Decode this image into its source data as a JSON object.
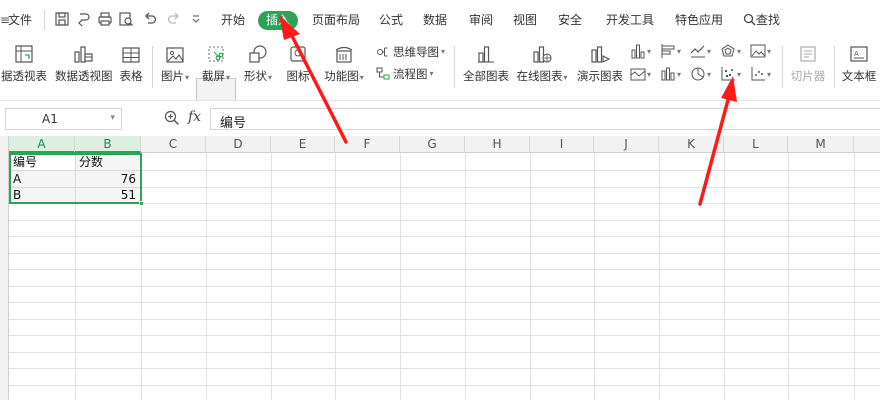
{
  "menubar": {
    "file_label": "文件",
    "tabs": [
      {
        "label": "开始",
        "active": false
      },
      {
        "label": "插入",
        "active": true
      },
      {
        "label": "页面布局",
        "active": false
      },
      {
        "label": "公式",
        "active": false
      },
      {
        "label": "数据",
        "active": false
      },
      {
        "label": "审阅",
        "active": false
      },
      {
        "label": "视图",
        "active": false
      },
      {
        "label": "安全",
        "active": false
      },
      {
        "label": "开发工具",
        "active": false
      },
      {
        "label": "特色应用",
        "active": false
      }
    ],
    "search_label": "查找",
    "accent_color": "#2ea357"
  },
  "ribbon": {
    "pivot_table": "据透视表",
    "pivot_chart": "数据透视图",
    "table": "表格",
    "picture": "图片",
    "screenshot": "截屏",
    "shapes": "形状",
    "icons": "图标",
    "function_chart": "功能图",
    "mind_map": "思维导图",
    "flowchart": "流程图",
    "all_charts": "全部图表",
    "online_charts": "在线图表",
    "demo_chart": "演示图表",
    "slicer": "切片器",
    "textbox": "文本框"
  },
  "formula_bar": {
    "cell_ref": "A1",
    "fx_label": "fx",
    "content": "编号"
  },
  "sheet": {
    "columns": [
      "A",
      "B",
      "C",
      "D",
      "E",
      "F",
      "G",
      "H",
      "I",
      "J",
      "K",
      "L",
      "M"
    ],
    "rows": [
      {
        "a": "编号",
        "b": "分数"
      },
      {
        "a": "A",
        "b": "76"
      },
      {
        "a": "B",
        "b": "51"
      }
    ],
    "selection": "A1:B3"
  },
  "annotations": {
    "arrow_color": "#ff1a1a"
  }
}
